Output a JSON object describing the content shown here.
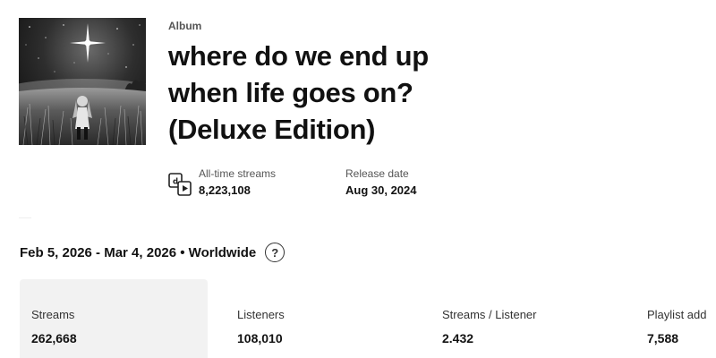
{
  "album": {
    "type_label": "Album",
    "title_lines": [
      "where do we end up",
      "when life goes on?",
      "(Deluxe Edition)"
    ]
  },
  "meta": {
    "streams_icon": "streams-icon",
    "alltime_label": "All-time streams",
    "alltime_value": "8,223,108",
    "release_label": "Release date",
    "release_value": "Aug 30, 2024"
  },
  "filter": {
    "range_text": "Feb 5, 2026 - Mar 4, 2026 • Worldwide",
    "help_glyph": "?"
  },
  "stats": [
    {
      "label": "Streams",
      "value": "262,668"
    },
    {
      "label": "Listeners",
      "value": "108,010"
    },
    {
      "label": "Streams / Listener",
      "value": "2.432"
    },
    {
      "label": "Playlist add",
      "value": "7,588"
    }
  ]
}
